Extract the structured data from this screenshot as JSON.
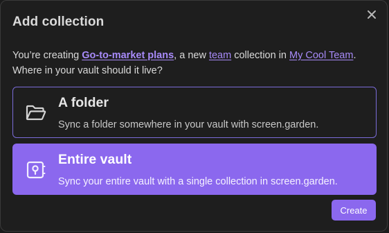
{
  "dialog": {
    "title": "Add collection",
    "description": {
      "prefix": "You’re creating ",
      "collection_name": "Go-to-market plans",
      "middle1": ", a new ",
      "collection_type": "team",
      "middle2": " collection in ",
      "team_name": "My Cool Team",
      "suffix": ". Where in your vault should it live?"
    },
    "options": [
      {
        "title": "A folder",
        "description": "Sync a folder somewhere in your vault with screen.garden.",
        "icon": "folder-open-icon",
        "selected": false
      },
      {
        "title": "Entire vault",
        "description": "Sync your entire vault with a single collection in screen.garden.",
        "icon": "vault-icon",
        "selected": true
      }
    ],
    "create_label": "Create",
    "close_icon": "close-icon"
  },
  "colors": {
    "accent": "#8b68ee",
    "link": "#a88bfa",
    "background": "#1e1e1e",
    "text": "#dadada"
  }
}
